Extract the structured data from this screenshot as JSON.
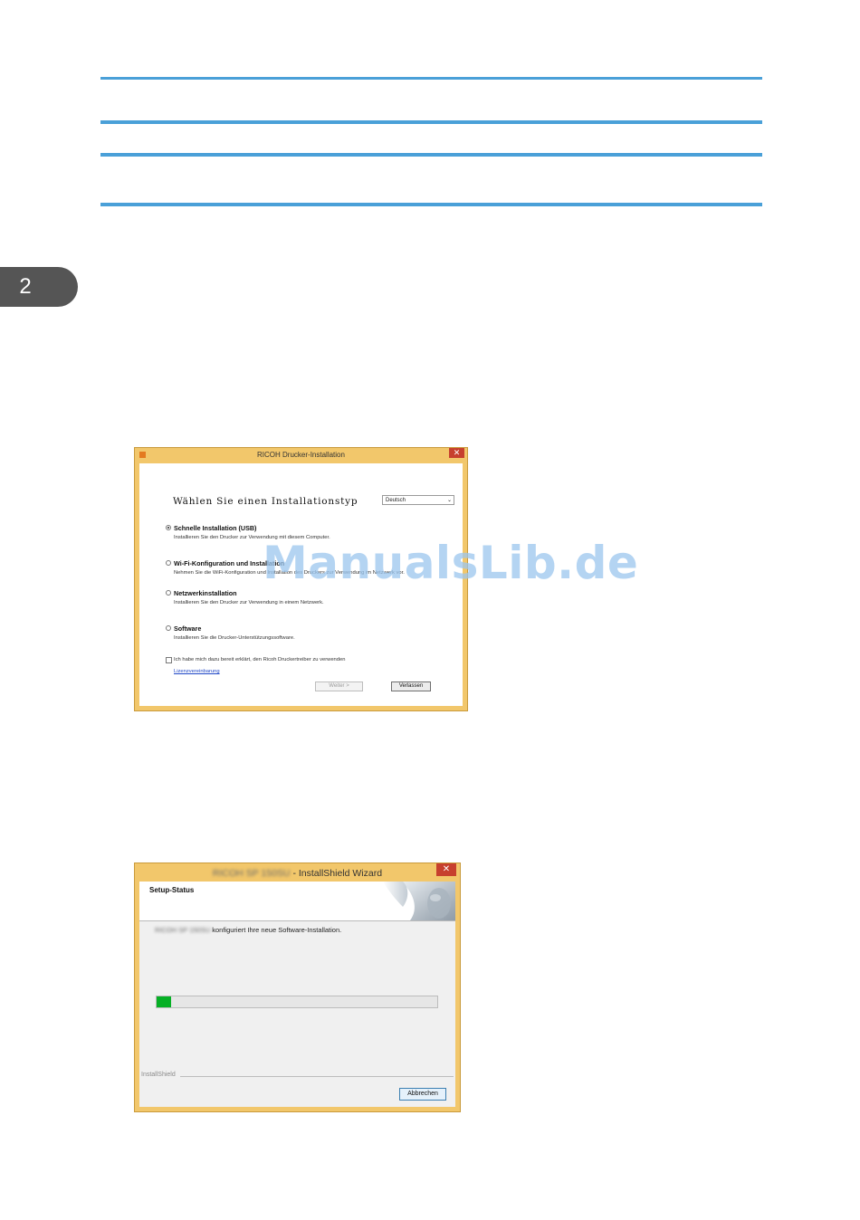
{
  "chapter": {
    "number": "2"
  },
  "watermark": "ManualsLib.de",
  "installer_window": {
    "title": "RICOH Drucker-Installation",
    "close_glyph": "✕",
    "heading": "Wählen Sie einen Installationstyp",
    "language": {
      "selected": "Deutsch",
      "arrow": "⌄"
    },
    "options": [
      {
        "label": "Schnelle Installation (USB)",
        "description": "Installieren Sie den Drucker zur Verwendung mit diesem Computer.",
        "selected": true
      },
      {
        "label": "Wi-Fi-Konfiguration und Installation",
        "description": "Nehmen Sie die WiFi-Konfiguration und Installation des Druckers zur Verwendung im Netzwerk vor.",
        "selected": false
      },
      {
        "label": "Netzwerkinstallation",
        "description": "Installieren Sie den Drucker zur Verwendung in einem Netzwerk.",
        "selected": false
      },
      {
        "label": "Software",
        "description": "Installieren Sie die Drucker-Unterstützungssoftware.",
        "selected": false
      }
    ],
    "agreement": {
      "label": "Ich habe mich dazu bereit erklärt, den Ricoh Druckertreiber zu verwenden",
      "checked": false
    },
    "license_link": "Lizenzvereinbarung",
    "buttons": {
      "next": "Weiter >",
      "exit": "Verlassen"
    }
  },
  "installshield_window": {
    "title_product": "RICOH SP 150SU",
    "title_suffix": "- InstallShield Wizard",
    "close_glyph": "✕",
    "header": "Setup-Status",
    "status_product": "RICOH SP 150SU",
    "status_text": "konfiguriert Ihre neue Software-Installation.",
    "progress": 0.05,
    "progress_color": "#06b025",
    "footer_label": "InstallShield",
    "cancel": "Abbrechen"
  }
}
